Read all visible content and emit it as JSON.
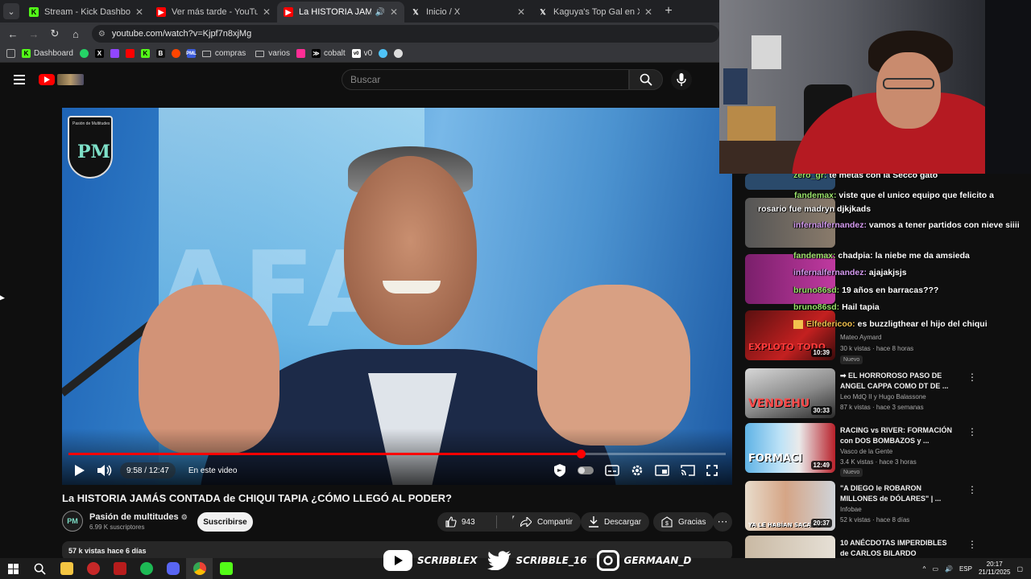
{
  "tabs": [
    {
      "label": "Stream - Kick Dashboard",
      "icon": "kick-icon",
      "color": "#53fc18",
      "active": false
    },
    {
      "label": "Ver más tarde - YouTube",
      "icon": "youtube-icon",
      "color": "#ff0000",
      "active": false
    },
    {
      "label": "La HISTORIA JAMÁS CONTA",
      "icon": "youtube-icon",
      "color": "#ff0000",
      "active": true
    },
    {
      "label": "Inicio / X",
      "icon": "x-icon",
      "color": "#ffffff",
      "active": false
    },
    {
      "label": "Kaguya's Top Gal en X: \"They m",
      "icon": "x-icon",
      "color": "#ffffff",
      "active": false
    }
  ],
  "address": {
    "url": "youtube.com/watch?v=Kjpf7n8xjMg"
  },
  "bookmarks": {
    "dashboard": "Dashboard",
    "compras": "compras",
    "varios": "varios",
    "cobalt": "cobalt",
    "v0": "v0"
  },
  "search": {
    "placeholder": "Buscar"
  },
  "player": {
    "logo_text": "Pasión de Multitudes",
    "logo_mark": "PM",
    "bg_text": "AFA",
    "time": "9:58 / 12:47",
    "chapter": "En este video",
    "progress": 0.78
  },
  "video": {
    "title": "La HISTORIA JAMÁS CONTADA de CHIQUI TAPIA ¿CÓMO LLEGÓ AL PODER?",
    "channel": "Pasión de multitudes",
    "subscribers": "6.99 K suscriptores",
    "subscribe": "Suscribirse",
    "likes": "943",
    "share": "Compartir",
    "download": "Descargar",
    "thanks": "Gracias",
    "views_date": "57 k vistas  hace 6 días"
  },
  "chat": [
    {
      "user": "zero_gr:",
      "text": " te metas con la Secco gato",
      "color": "#9be36b"
    },
    {
      "user": "fandemax:",
      "text": " viste que el unico equipo que felicito a rosario fue madryn djkjkads",
      "color": "#9be36b"
    },
    {
      "user": "infernalfernandez:",
      "text": " vamos a tener partidos con nieve siiii",
      "color": "#d59bf0"
    },
    {
      "user": "fandemax:",
      "text": " chadpia: la niebe me da amsieda",
      "color": "#9be36b"
    },
    {
      "user": "infernalfernandez:",
      "text": " ajajakjsjs",
      "color": "#d59bf0"
    },
    {
      "user": "bruno86sd:",
      "text": " 19 años en barracas???",
      "color": "#9be36b"
    },
    {
      "user": "bruno86sd:",
      "text": " Hail tapia",
      "color": "#9be36b"
    },
    {
      "user": "Elfedericoo:",
      "text": " es buzzligthear el hijo del chiqui",
      "color": "#f2c14e"
    }
  ],
  "recommendations": [
    {
      "title": "",
      "channel": "Mateo Aymard",
      "meta": "30 k vistas · hace 8 horas",
      "badge": "Nuevo",
      "duration": "10:39",
      "thumb_text": "EXPLOTO TODO"
    },
    {
      "title": "➡ EL HORROROSO PASO DE ANGEL CAPPA COMO DT DE ...",
      "channel": "Leo MdQ II  y Hugo Balassone",
      "meta": "87 k vistas · hace 3 semanas",
      "badge": "",
      "duration": "30:33",
      "thumb_text": "VENDEHU"
    },
    {
      "title": "RACING vs RIVER: FORMACIÓN con DOS BOMBAZOS y ...",
      "channel": "Vasco de la Gente",
      "meta": "3.4 K vistas · hace 3 horas",
      "badge": "Nuevo",
      "duration": "12:49",
      "thumb_text": "FORMACI"
    },
    {
      "title": "\"A DIEGO le ROBARON MILLONES de DÓLARES\" | ...",
      "channel": "Infobae",
      "meta": "52 k vistas · hace 8 días",
      "badge": "",
      "duration": "20:37",
      "thumb_text": "YA LE HABÍAN SACADO"
    },
    {
      "title": "10 ANÉCDOTAS IMPERDIBLES de CARLOS BILARDO",
      "channel": "",
      "meta": "",
      "badge": "",
      "duration": "",
      "thumb_text": ""
    }
  ],
  "socials": {
    "youtube": "SCRIBBLEX",
    "twitter": "SCRIBBLE_16",
    "instagram": "GERMAAN_D"
  },
  "tray": {
    "lang": "ESP",
    "time": "20:17",
    "date": "21/11/2025"
  }
}
